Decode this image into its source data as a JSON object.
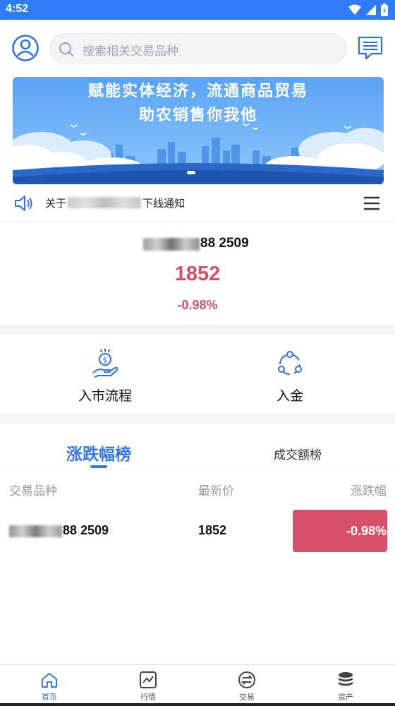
{
  "status_bar": {
    "time": "4:52"
  },
  "search": {
    "placeholder": "搜索相关交易品种"
  },
  "banner": {
    "line1": "赋能实体经济，流通商品贸易",
    "line2": "助农销售你我他"
  },
  "notice": {
    "prefix": "关于",
    "suffix": "下线通知"
  },
  "ticker": {
    "name_suffix": "88 2509",
    "price": "1852",
    "change": "-0.98%"
  },
  "shortcuts": [
    {
      "label": "入市流程",
      "icon": "hand-dollar-icon"
    },
    {
      "label": "入金",
      "icon": "share-icon"
    }
  ],
  "tabs": {
    "active": "涨跌幅榜",
    "other": "成交额榜"
  },
  "table": {
    "headers": [
      "交易品种",
      "最新价",
      "涨跌幅"
    ],
    "rows": [
      {
        "name_suffix": "88 2509",
        "price": "1852",
        "change": "-0.98%"
      }
    ]
  },
  "bottom_nav": [
    {
      "label": "首页",
      "icon": "home-icon",
      "active": true
    },
    {
      "label": "行情",
      "icon": "chart-icon",
      "active": false
    },
    {
      "label": "交易",
      "icon": "exchange-icon",
      "active": false
    },
    {
      "label": "资产",
      "icon": "coins-icon",
      "active": false
    }
  ],
  "colors": {
    "accent": "#3778e0",
    "status_bar": "#2f7cf6",
    "down": "#d0516b"
  }
}
